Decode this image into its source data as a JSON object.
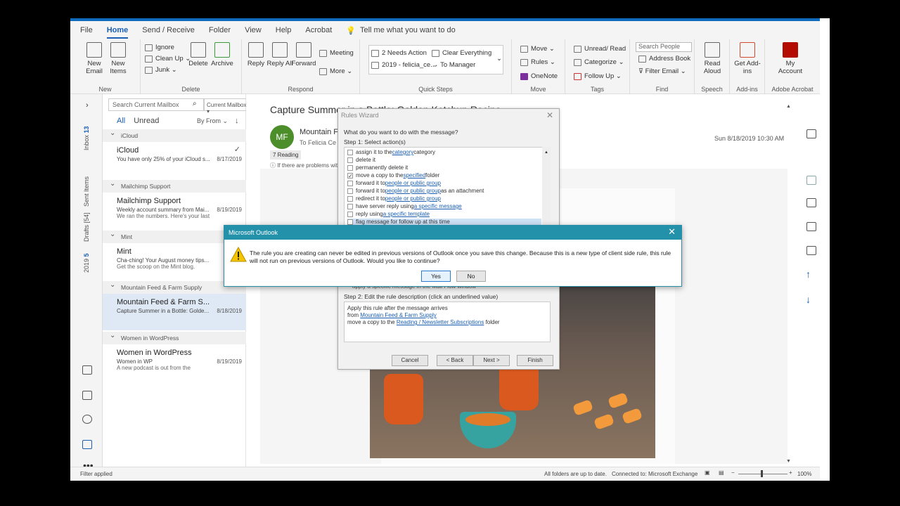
{
  "menu": {
    "items": [
      "File",
      "Home",
      "Send / Receive",
      "Folder",
      "View",
      "Help",
      "Acrobat"
    ],
    "active": "Home",
    "tell_me": "Tell me what you want to do"
  },
  "ribbon": {
    "new": {
      "new_email": "New Email",
      "new_items": "New Items",
      "group": "New"
    },
    "delete": {
      "ignore": "Ignore",
      "clean_up": "Clean Up",
      "junk": "Junk",
      "delete": "Delete",
      "archive": "Archive",
      "group": "Delete"
    },
    "respond": {
      "reply": "Reply",
      "reply_all": "Reply All",
      "forward": "Forward",
      "meeting": "Meeting",
      "more": "More",
      "group": "Respond"
    },
    "quick_steps": {
      "items": [
        "2 Needs Action",
        "Clear Everything",
        "2019 - felicia_ce...",
        "To Manager"
      ],
      "group": "Quick Steps"
    },
    "move": {
      "move": "Move",
      "rules": "Rules",
      "onenote": "OneNote",
      "group": "Move"
    },
    "tags": {
      "unread_read": "Unread/ Read",
      "categorize": "Categorize",
      "follow_up": "Follow Up",
      "group": "Tags"
    },
    "find": {
      "search_people": "Search People",
      "address_book": "Address Book",
      "filter_email": "Filter Email",
      "group": "Find"
    },
    "speech": {
      "read_aloud": "Read Aloud",
      "group": "Speech"
    },
    "addins": {
      "get_addins": "Get Add-ins",
      "group": "Add-ins"
    },
    "acrobat": {
      "my_account": "My Account",
      "group": "Adobe Acrobat"
    }
  },
  "leftnav": {
    "tabs": [
      {
        "label": "Inbox",
        "count": "13"
      },
      {
        "label": "Sent Items",
        "count": ""
      },
      {
        "label": "Drafts",
        "count": "[54]"
      },
      {
        "label": "2019",
        "count": "5"
      }
    ]
  },
  "msglist": {
    "search_placeholder": "Search Current Mailbox",
    "scope": "Current Mailbox",
    "filter_all": "All",
    "filter_unread": "Unread",
    "sort": "By From",
    "groups": [
      {
        "name": "iCloud",
        "sender": "iCloud",
        "subject": "You have only 25% of your iCloud s...",
        "preview": "",
        "date": "8/17/2019"
      },
      {
        "name": "Mailchimp Support",
        "sender": "Mailchimp Support",
        "subject": "Weekly account summary from Mai...",
        "preview": "We ran the numbers. Here's your last",
        "date": "8/19/2019"
      },
      {
        "name": "Mint",
        "sender": "Mint",
        "subject": "Cha-ching! Your August money tips...",
        "preview": "Get the scoop on the Mint blog.",
        "date": "8/"
      },
      {
        "name": "Mountain Feed & Farm Supply",
        "sender": "Mountain Feed & Farm S...",
        "subject": "Capture Summer in a Bottle: Golde...",
        "preview": "",
        "date": "8/18/2019"
      },
      {
        "name": "Women in WordPress",
        "sender": "Women in WordPress",
        "subject": "Women in WP",
        "preview": "A new podcast is out from the",
        "date": "8/19/2019"
      }
    ]
  },
  "reading": {
    "subject": "Capture Summer in a Bottle: Golden Ketchup Recipe",
    "avatar": "MF",
    "sender": "Mountain F",
    "to": "To   Felicia Ce",
    "datetime": "Sun 8/18/2019 10:30 AM",
    "tag": "7 Reading",
    "info": "If there are problems wit"
  },
  "wizard": {
    "title": "Rules Wizard",
    "question": "What do you want to do with the message?",
    "step1": "Step 1: Select action(s)",
    "actions": [
      {
        "pre": "assign it to the ",
        "link": "category",
        "post": " category",
        "checked": false
      },
      {
        "pre": "delete it",
        "link": "",
        "post": "",
        "checked": false
      },
      {
        "pre": "permanently delete it",
        "link": "",
        "post": "",
        "checked": false
      },
      {
        "pre": "move a copy to the ",
        "link": "specified",
        "post": " folder",
        "checked": true
      },
      {
        "pre": "forward it to ",
        "link": "people or public group",
        "post": "",
        "checked": false
      },
      {
        "pre": "forward it to ",
        "link": "people or public group",
        "post": " as an attachment",
        "checked": false
      },
      {
        "pre": "redirect it to ",
        "link": "people or public group",
        "post": "",
        "checked": false
      },
      {
        "pre": "have server reply using ",
        "link": "a specific message",
        "post": "",
        "checked": false
      },
      {
        "pre": "reply using ",
        "link": "a specific template",
        "post": "",
        "checked": false
      },
      {
        "pre": "flag message for follow up at this time",
        "link": "",
        "post": "",
        "checked": false
      }
    ],
    "partial_row": "apply   a specific message   in the Mail Flow window",
    "step2": "Step 2: Edit the rule description (click an underlined value)",
    "desc_line1": "Apply this rule after the message arrives",
    "desc_from_pre": "from ",
    "desc_from_link": "Mountain Feed & Farm Supply",
    "desc_move_pre": "move a copy to the ",
    "desc_move_link": "Reading / Newsletter Subscriptions",
    "desc_move_post": " folder",
    "buttons": {
      "cancel": "Cancel",
      "back": "< Back",
      "next": "Next >",
      "finish": "Finish"
    }
  },
  "msgbox": {
    "title": "Microsoft Outlook",
    "text": "The rule you are creating can never be edited in previous versions of Outlook once you save this change. Because this is a new type of client side rule, this rule will not run on previous versions of Outlook. Would you like to continue?",
    "yes": "Yes",
    "no": "No"
  },
  "status": {
    "left": "Filter applied",
    "sync": "All folders are up to date.",
    "connection": "Connected to: Microsoft Exchange",
    "zoom": "100%"
  }
}
